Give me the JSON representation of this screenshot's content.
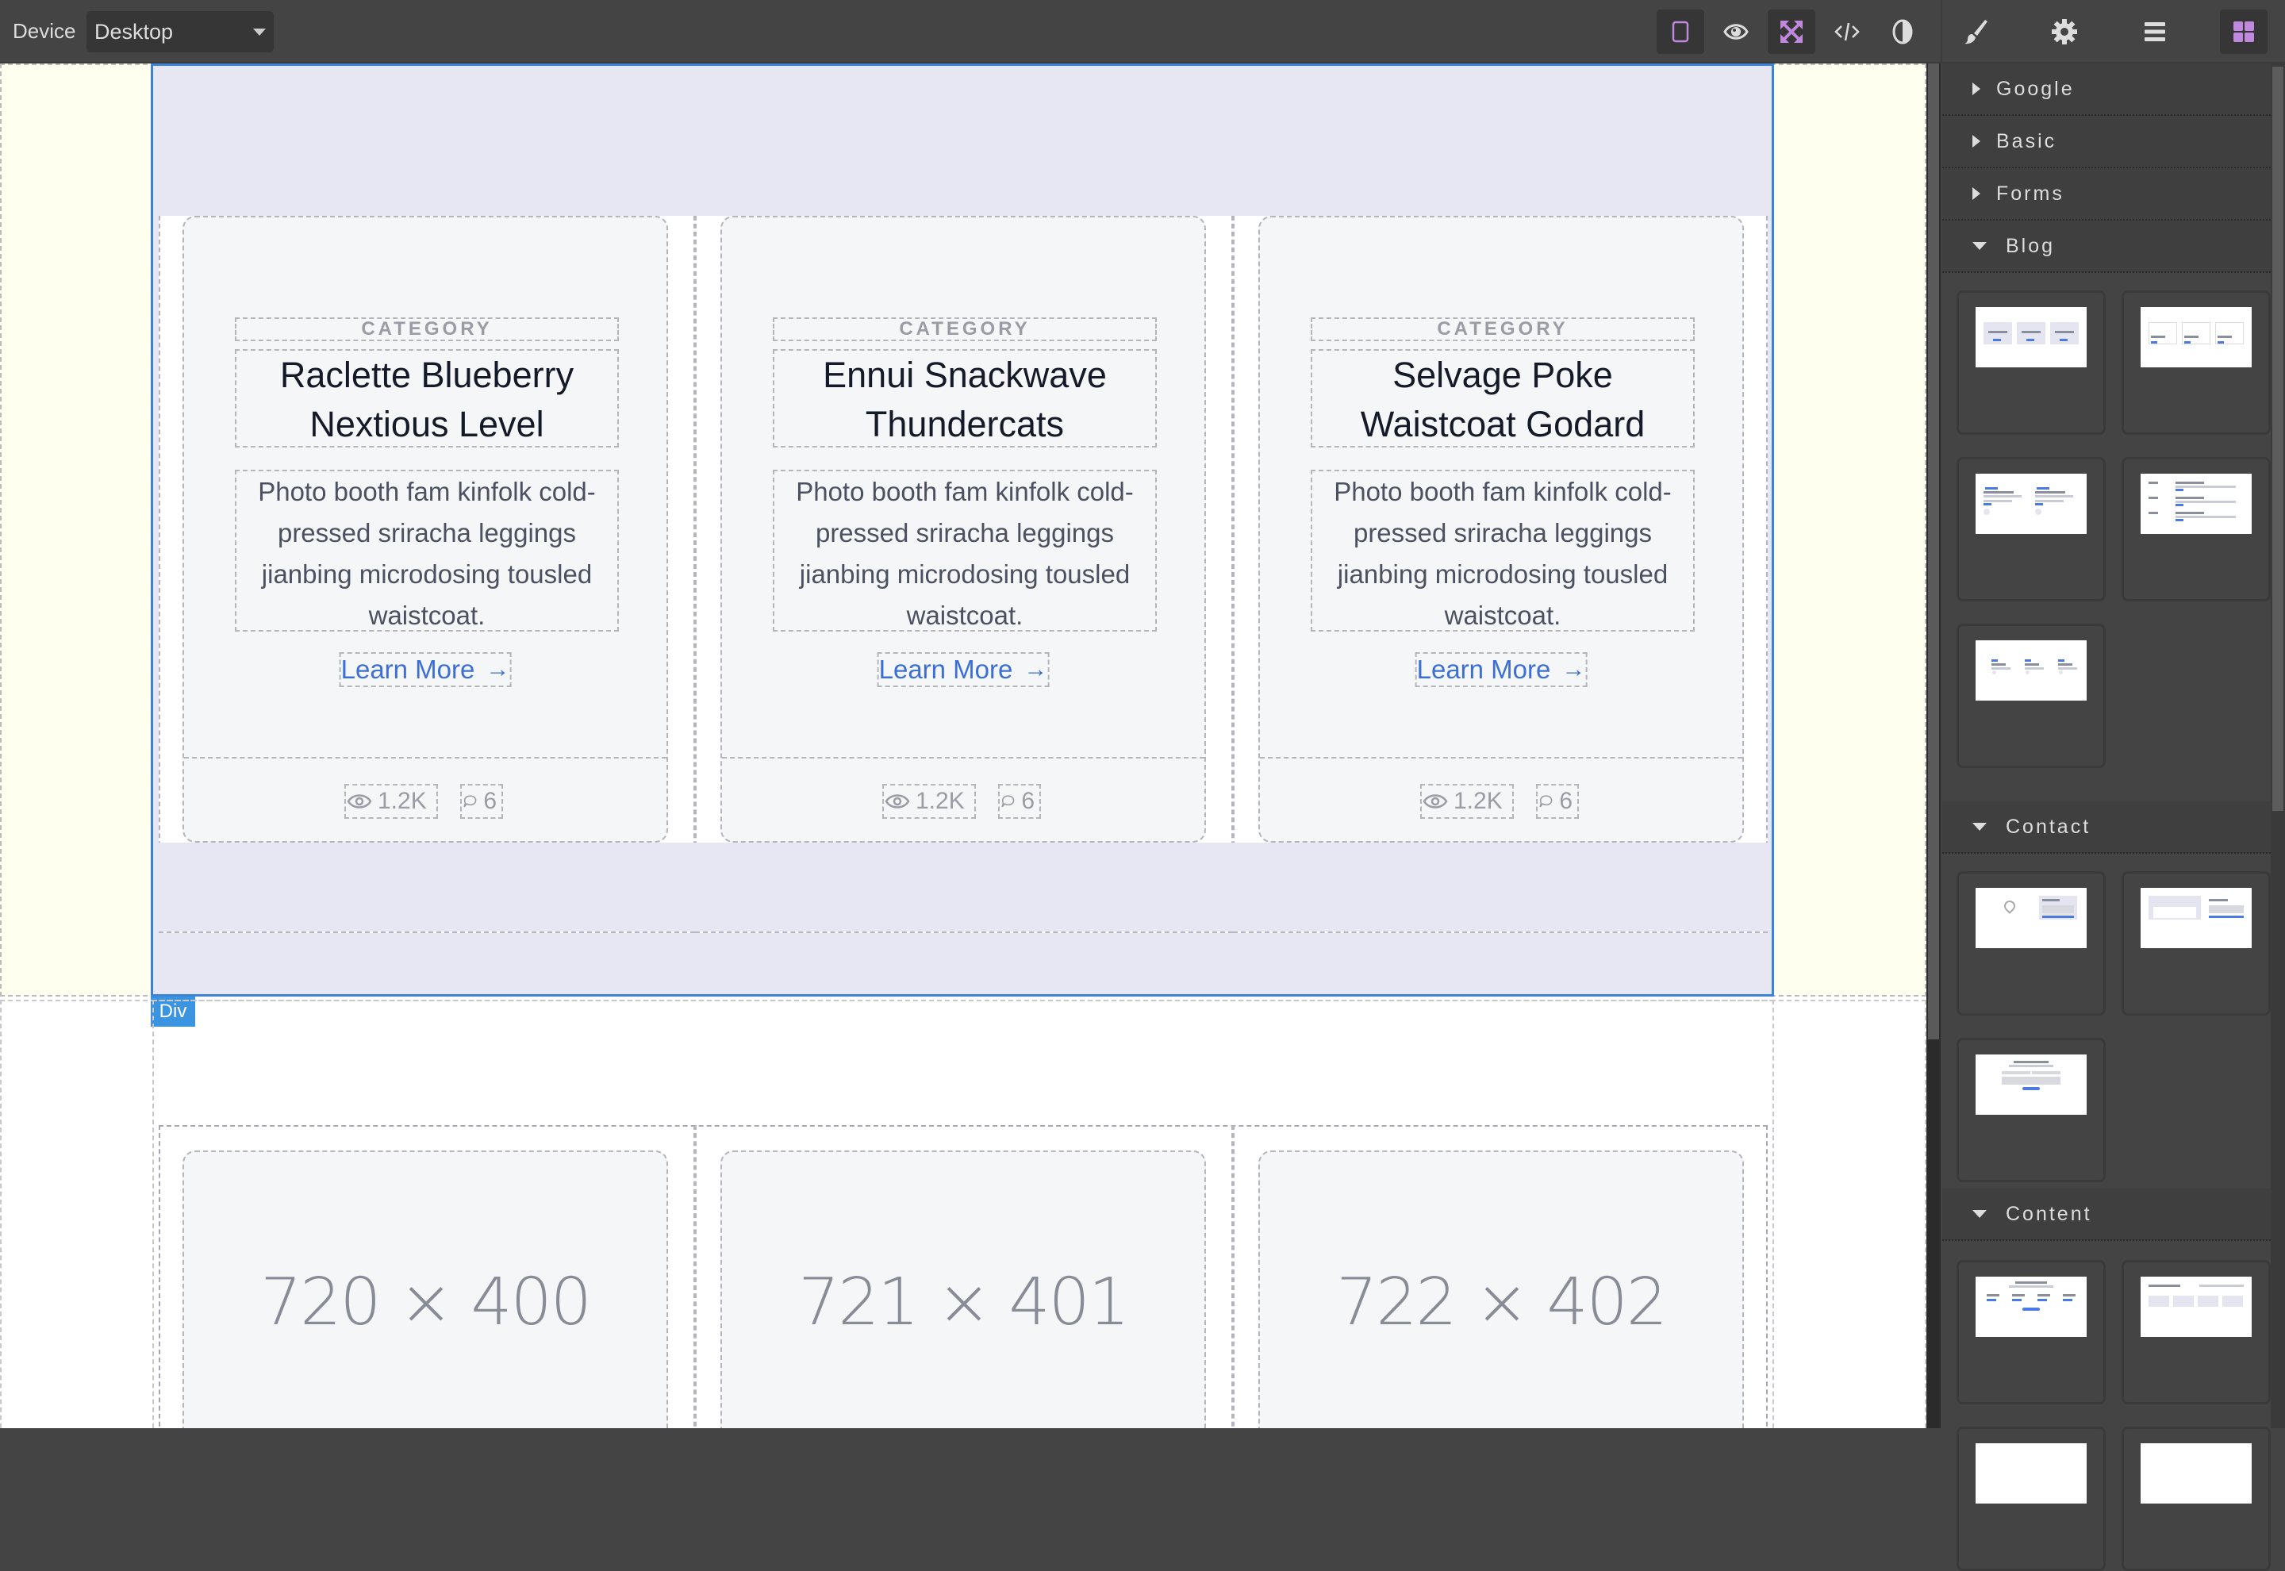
{
  "topbar": {
    "device_label": "Device",
    "device_value": "Desktop",
    "tools": [
      {
        "name": "sw-visibility",
        "icon": "square-outline-icon",
        "active": true
      },
      {
        "name": "preview",
        "icon": "eye-icon",
        "active": false
      },
      {
        "name": "fullscreen",
        "icon": "expand-arrows-icon",
        "active": true
      },
      {
        "name": "export-code",
        "icon": "code-icon",
        "active": false
      },
      {
        "name": "contrast",
        "icon": "contrast-icon",
        "active": false
      }
    ],
    "panels": [
      {
        "name": "style-manager",
        "icon": "paintbrush-icon",
        "active": false
      },
      {
        "name": "settings",
        "icon": "gear-icon",
        "active": false
      },
      {
        "name": "layer-manager",
        "icon": "bars-icon",
        "active": false
      },
      {
        "name": "blocks",
        "icon": "grid-blocks-icon",
        "active": true
      }
    ],
    "accent_color": "#c088de"
  },
  "canvas": {
    "selected_badge": "Div",
    "selection_color": "#3b82d9",
    "cards": [
      {
        "category": "CATEGORY",
        "title": "Raclette Blueberry Nextious Level",
        "description": "Photo booth fam kinfolk cold-pressed sriracha leggings jianbing microdosing tousled waistcoat.",
        "link": "Learn More",
        "views": "1.2K",
        "comments": "6"
      },
      {
        "category": "CATEGORY",
        "title": "Ennui Snackwave Thundercats",
        "description": "Photo booth fam kinfolk cold-pressed sriracha leggings jianbing microdosing tousled waistcoat.",
        "link": "Learn More",
        "views": "1.2K",
        "comments": "6"
      },
      {
        "category": "CATEGORY",
        "title": "Selvage Poke Waistcoat Godard",
        "description": "Photo booth fam kinfolk cold-pressed sriracha leggings jianbing microdosing tousled waistcoat.",
        "link": "Learn More",
        "views": "1.2K",
        "comments": "6"
      }
    ],
    "placeholders": [
      "720 × 400",
      "721 × 401",
      "722 × 402"
    ],
    "link_color": "#3b6fd6"
  },
  "blocks_panel": {
    "categories": [
      {
        "label": "Google",
        "expanded": false
      },
      {
        "label": "Basic",
        "expanded": false
      },
      {
        "label": "Forms",
        "expanded": false
      },
      {
        "label": "Blog",
        "expanded": true,
        "block_count": 5
      },
      {
        "label": "Contact",
        "expanded": true,
        "block_count": 3
      },
      {
        "label": "Content",
        "expanded": true,
        "block_count": 4
      }
    ]
  }
}
